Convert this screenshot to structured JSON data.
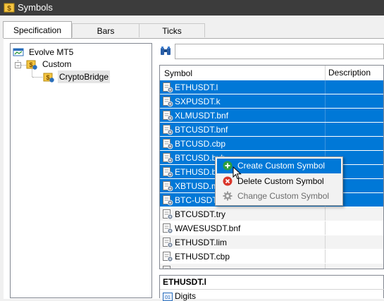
{
  "window": {
    "title": "Symbols"
  },
  "tabs": [
    {
      "label": "Specification",
      "active": true
    },
    {
      "label": "Bars",
      "active": false
    },
    {
      "label": "Ticks",
      "active": false
    }
  ],
  "tree": {
    "root": "Evolve MT5",
    "folder": "Custom",
    "leaf": "CryptoBridge"
  },
  "search": {
    "value": "",
    "placeholder": ""
  },
  "grid": {
    "columns": [
      "Symbol",
      "Description"
    ],
    "rows": [
      {
        "symbol": "ETHUSDT.l",
        "description": "",
        "state": "selected"
      },
      {
        "symbol": "SXPUSDT.k",
        "description": "",
        "state": "selected"
      },
      {
        "symbol": "XLMUSDT.bnf",
        "description": "",
        "state": "selected"
      },
      {
        "symbol": "BTCUSDT.bnf",
        "description": "",
        "state": "selected"
      },
      {
        "symbol": "BTCUSD.cbp",
        "description": "",
        "state": "selected"
      },
      {
        "symbol": "BTCUSD.byb",
        "description": "",
        "state": "selected"
      },
      {
        "symbol": "ETHUSD.byb",
        "description": "",
        "state": "selected"
      },
      {
        "symbol": "XBTUSD.mex",
        "description": "",
        "state": "selected"
      },
      {
        "symbol": "BTC-USDT.k",
        "description": "",
        "state": "selected"
      },
      {
        "symbol": "BTCUSDT.try",
        "description": "",
        "state": "alt"
      },
      {
        "symbol": "WAVESUSDT.bnf",
        "description": "",
        "state": "plain"
      },
      {
        "symbol": "ETHUSDT.lim",
        "description": "",
        "state": "alt"
      },
      {
        "symbol": "ETHUSDT.cbp",
        "description": "",
        "state": "plain"
      },
      {
        "symbol": "",
        "description": "",
        "state": "alt"
      }
    ]
  },
  "details": {
    "title": "ETHUSDT.l",
    "first_field": "Digits"
  },
  "context_menu": {
    "items": [
      {
        "label": "Create Custom Symbol",
        "icon": "plus-circle-icon",
        "state": "highlighted"
      },
      {
        "label": "Delete Custom Symbol",
        "icon": "delete-circle-icon",
        "state": "normal"
      },
      {
        "label": "Change Custom Symbol",
        "icon": "gear-icon",
        "state": "disabled"
      }
    ]
  },
  "colors": {
    "selection": "#0078d7",
    "titlebar": "#3c3c3c",
    "delete": "#d9362b",
    "create": "#2e9e3e"
  }
}
